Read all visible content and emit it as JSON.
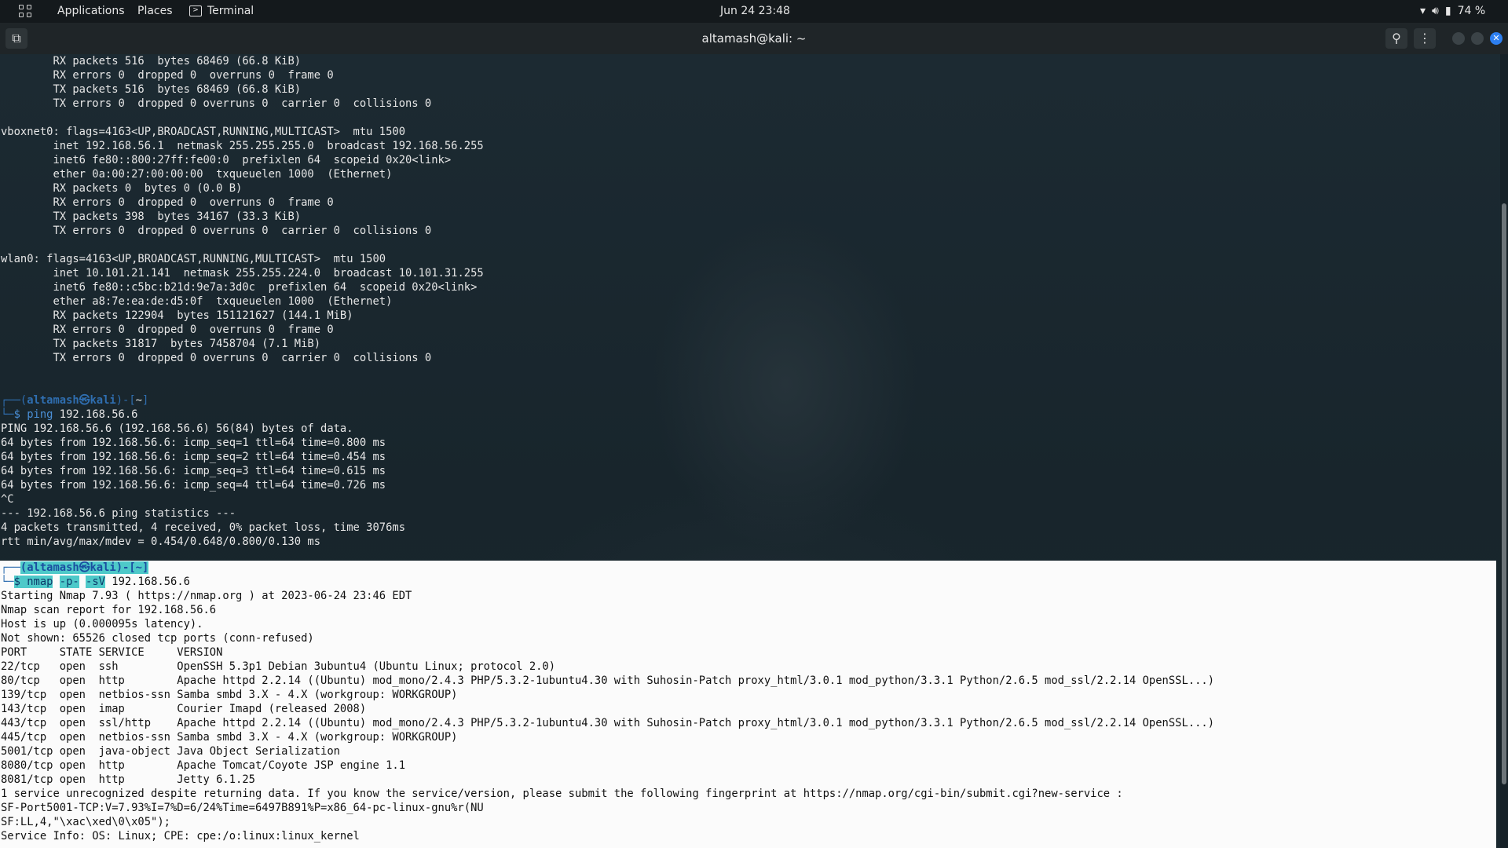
{
  "panel": {
    "applications": "Applications",
    "places": "Places",
    "terminal_app": "Terminal",
    "datetime": "Jun 24  23:48",
    "battery": "74 %",
    "icons": [
      "wifi-icon",
      "volume-icon",
      "battery-icon"
    ]
  },
  "window": {
    "title": "altamash@kali: ~"
  },
  "terminal": {
    "ifconfig_lines": [
      "        RX packets 516  bytes 68469 (66.8 KiB)",
      "        RX errors 0  dropped 0  overruns 0  frame 0",
      "        TX packets 516  bytes 68469 (66.8 KiB)",
      "        TX errors 0  dropped 0 overruns 0  carrier 0  collisions 0",
      "",
      "vboxnet0: flags=4163<UP,BROADCAST,RUNNING,MULTICAST>  mtu 1500",
      "        inet 192.168.56.1  netmask 255.255.255.0  broadcast 192.168.56.255",
      "        inet6 fe80::800:27ff:fe00:0  prefixlen 64  scopeid 0x20<link>",
      "        ether 0a:00:27:00:00:00  txqueuelen 1000  (Ethernet)",
      "        RX packets 0  bytes 0 (0.0 B)",
      "        RX errors 0  dropped 0  overruns 0  frame 0",
      "        TX packets 398  bytes 34167 (33.3 KiB)",
      "        TX errors 0  dropped 0 overruns 0  carrier 0  collisions 0",
      "",
      "wlan0: flags=4163<UP,BROADCAST,RUNNING,MULTICAST>  mtu 1500",
      "        inet 10.101.21.141  netmask 255.255.224.0  broadcast 10.101.31.255",
      "        inet6 fe80::c5bc:b21d:9e7a:3d0c  prefixlen 64  scopeid 0x20<link>",
      "        ether a8:7e:ea:de:d5:0f  txqueuelen 1000  (Ethernet)",
      "        RX packets 122904  bytes 151121627 (144.1 MiB)",
      "        RX errors 0  dropped 0  overruns 0  frame 0",
      "        TX packets 31817  bytes 7458704 (7.1 MiB)",
      "        TX errors 0  dropped 0 overruns 0  carrier 0  collisions 0",
      "",
      ""
    ],
    "prompt_user": "altamash",
    "prompt_at": "㉿",
    "prompt_host": "kali",
    "prompt_dir": "~",
    "ping_command": "ping",
    "ping_args": "192.168.56.6",
    "ping_lines": [
      "PING 192.168.56.6 (192.168.56.6) 56(84) bytes of data.",
      "64 bytes from 192.168.56.6: icmp_seq=1 ttl=64 time=0.800 ms",
      "64 bytes from 192.168.56.6: icmp_seq=2 ttl=64 time=0.454 ms",
      "64 bytes from 192.168.56.6: icmp_seq=3 ttl=64 time=0.615 ms",
      "64 bytes from 192.168.56.6: icmp_seq=4 ttl=64 time=0.726 ms",
      "^C",
      "--- 192.168.56.6 ping statistics ---",
      "4 packets transmitted, 4 received, 0% packet loss, time 3076ms",
      "rtt min/avg/max/mdev = 0.454/0.648/0.800/0.130 ms"
    ],
    "nmap_command": "nmap",
    "nmap_flag1": "-p-",
    "nmap_flag2": "-sV",
    "nmap_target": "192.168.56.6",
    "nmap_lines": [
      "Starting Nmap 7.93 ( https://nmap.org ) at 2023-06-24 23:46 EDT",
      "Nmap scan report for 192.168.56.6",
      "Host is up (0.000095s latency).",
      "Not shown: 65526 closed tcp ports (conn-refused)",
      "PORT     STATE SERVICE     VERSION",
      "22/tcp   open  ssh         OpenSSH 5.3p1 Debian 3ubuntu4 (Ubuntu Linux; protocol 2.0)",
      "80/tcp   open  http        Apache httpd 2.2.14 ((Ubuntu) mod_mono/2.4.3 PHP/5.3.2-1ubuntu4.30 with Suhosin-Patch proxy_html/3.0.1 mod_python/3.3.1 Python/2.6.5 mod_ssl/2.2.14 OpenSSL...)",
      "139/tcp  open  netbios-ssn Samba smbd 3.X - 4.X (workgroup: WORKGROUP)",
      "143/tcp  open  imap        Courier Imapd (released 2008)",
      "443/tcp  open  ssl/http    Apache httpd 2.2.14 ((Ubuntu) mod_mono/2.4.3 PHP/5.3.2-1ubuntu4.30 with Suhosin-Patch proxy_html/3.0.1 mod_python/3.3.1 Python/2.6.5 mod_ssl/2.2.14 OpenSSL...)",
      "445/tcp  open  netbios-ssn Samba smbd 3.X - 4.X (workgroup: WORKGROUP)",
      "5001/tcp open  java-object Java Object Serialization",
      "8080/tcp open  http        Apache Tomcat/Coyote JSP engine 1.1",
      "8081/tcp open  http        Jetty 6.1.25",
      "1 service unrecognized despite returning data. If you know the service/version, please submit the following fingerprint at https://nmap.org/cgi-bin/submit.cgi?new-service :",
      "SF-Port5001-TCP:V=7.93%I=7%D=6/24%Time=6497B891%P=x86_64-pc-linux-gnu%r(NU",
      "SF:LL,4,\"\\xac\\xed\\0\\x05\");",
      "Service Info: OS: Linux; CPE: cpe:/o:linux:linux_kernel"
    ]
  }
}
